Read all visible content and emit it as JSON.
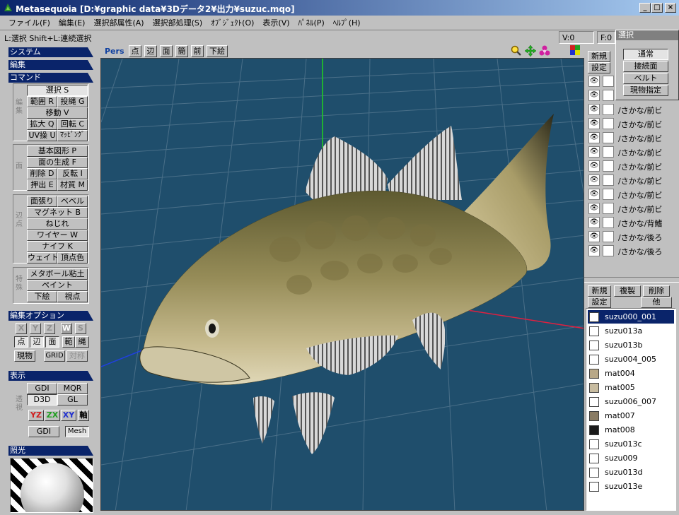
{
  "window": {
    "title": "Metasequoia [D:¥graphic data¥3Dデータ2¥出力¥suzuc.mqo]"
  },
  "menu": [
    "ファイル(F)",
    "編集(E)",
    "選択部属性(A)",
    "選択部処理(S)",
    "ｵﾌﾞｼﾞｪｸﾄ(O)",
    "表示(V)",
    "ﾊﾟﾈﾙ(P)",
    "ﾍﾙﾌﾟ(H)"
  ],
  "status": {
    "hint": "L:選択  Shift+L:連続選択",
    "v_count": "V:0",
    "f_count": "F:0"
  },
  "selection_panel": {
    "title": "選択",
    "buttons": [
      "通常",
      "接続面",
      "ベルト",
      "現物指定"
    ]
  },
  "left_panel": {
    "sections": {
      "system": "システム",
      "edit": "編集",
      "command": "コマンド",
      "edit_option": "編集オプション",
      "display": "表示",
      "lighting": "照光"
    },
    "groups": {
      "edit": "編集",
      "face": "面",
      "vertex": "辺点",
      "special": "特殊",
      "projection": "透視"
    },
    "edit_buttons": [
      "選択 S",
      "範囲 R",
      "投縄 G",
      "移動 V",
      "拡大 Q",
      "回転 C",
      "UV操 U",
      "ﾏｯﾋﾟﾝｸﾞ"
    ],
    "face_buttons": [
      "基本図形 P",
      "面の生成 F",
      "削除 D",
      "反転 I",
      "押出 E",
      "材質 M"
    ],
    "vertex_buttons": [
      "面張り",
      "ベベル",
      "マグネット B",
      "ねじれ",
      "ワイヤー W",
      "ナイフ K",
      "ウェイト",
      "頂点色"
    ],
    "special_buttons": [
      "メタボール粘土",
      "ペイント",
      "下絵",
      "視点"
    ],
    "axis_toggles": [
      "X",
      "Y",
      "Z",
      "W",
      "S"
    ],
    "option_buttons": [
      "点",
      "辺",
      "面",
      "範",
      "縄"
    ],
    "option_row3": [
      "現物",
      "GRID",
      "対称"
    ],
    "display_buttons": [
      "GDI",
      "MQR",
      "D3D",
      "GL"
    ],
    "plane_buttons": [
      "YZ",
      "ZX",
      "XY",
      "軸"
    ],
    "bottom_buttons": [
      "GDI",
      "Mesh"
    ]
  },
  "viewport_toolbar": {
    "mode": "Pers",
    "buttons": [
      "点",
      "辺",
      "面",
      "簡",
      "前",
      "下絵"
    ]
  },
  "object_panel": {
    "top_buttons": [
      "新規",
      "設定"
    ],
    "objects": [
      "",
      "",
      "/さかな/前ビ",
      "/さかな/前ビ",
      "/さかな/前ビ",
      "/さかな/前ビ",
      "/さかな/前ビ",
      "/さかな/前ビ",
      "/さかな/前ビ",
      "/さかな/前ビ",
      "/さかな/背鰭",
      "/さかな/後ろ",
      "/さかな/後ろ"
    ]
  },
  "material_panel": {
    "buttons": [
      "新規",
      "複製",
      "削除",
      "設定",
      "他"
    ],
    "materials": [
      {
        "name": "suzu000_001",
        "color": "#ffffff",
        "selected": true
      },
      {
        "name": "suzu013a",
        "color": "#ffffff"
      },
      {
        "name": "suzu013b",
        "color": "#ffffff"
      },
      {
        "name": "suzu004_005",
        "color": "#ffffff"
      },
      {
        "name": "mat004",
        "color": "#b8a888"
      },
      {
        "name": "mat005",
        "color": "#c8bca0"
      },
      {
        "name": "suzu006_007",
        "color": "#ffffff"
      },
      {
        "name": "mat007",
        "color": "#8a7c64"
      },
      {
        "name": "mat008",
        "color": "#1a1a1a"
      },
      {
        "name": "suzu013c",
        "color": "#ffffff"
      },
      {
        "name": "suzu009",
        "color": "#ffffff"
      },
      {
        "name": "suzu013d",
        "color": "#ffffff"
      },
      {
        "name": "suzu013e",
        "color": "#ffffff"
      }
    ]
  }
}
